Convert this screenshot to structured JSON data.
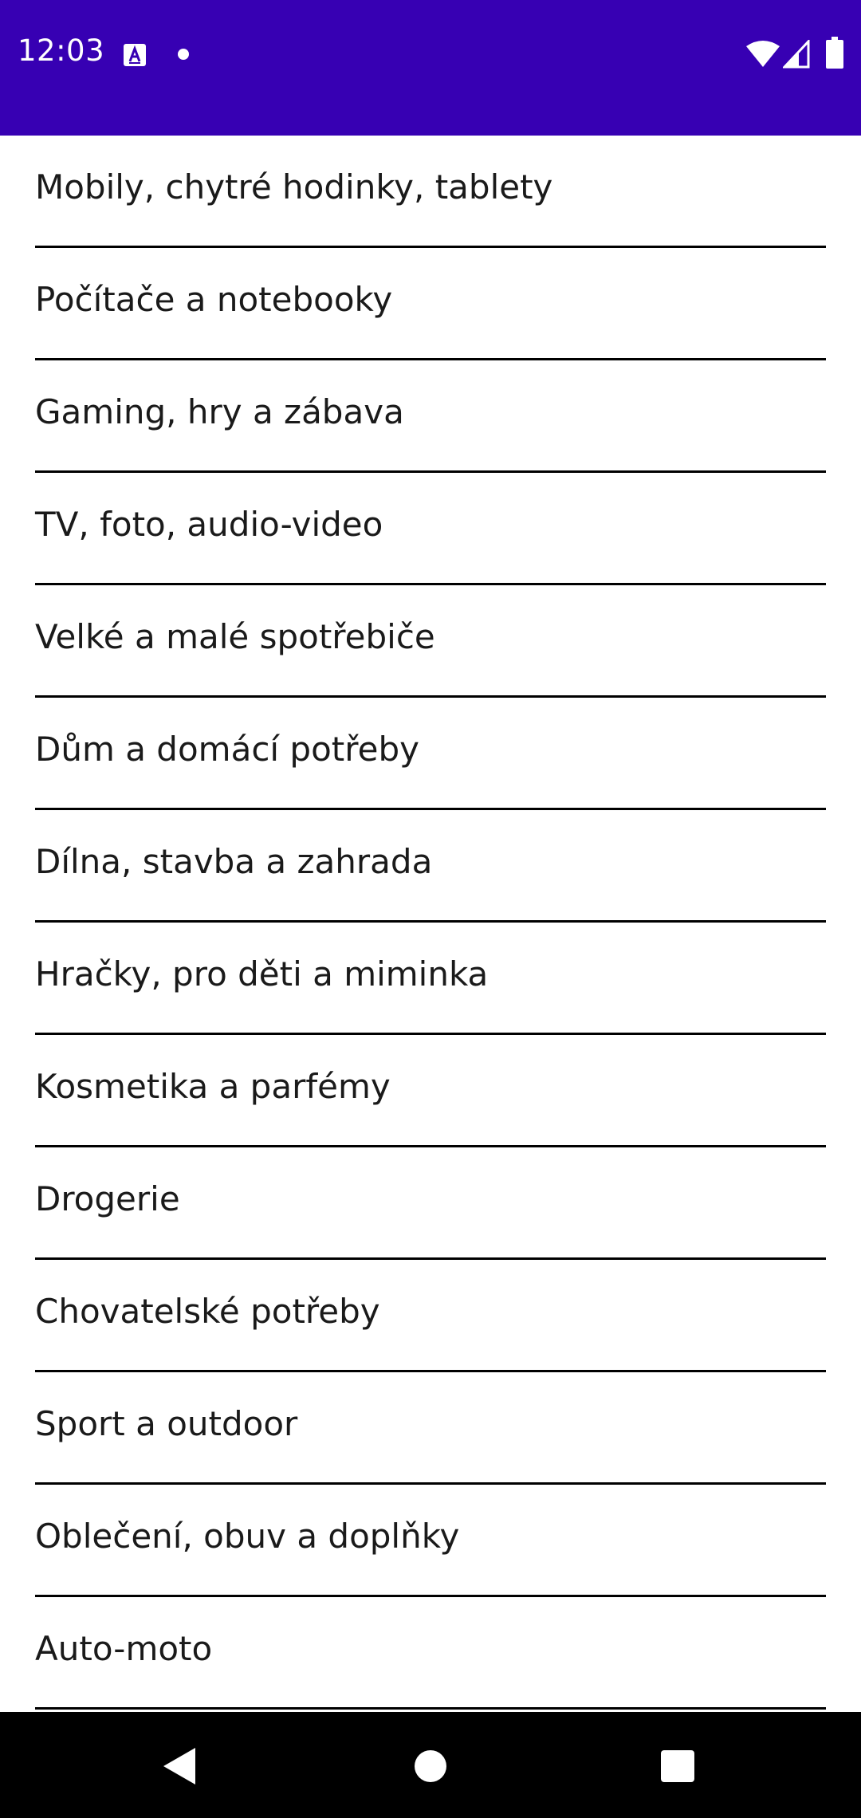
{
  "status_bar": {
    "time": "12:03",
    "icons": [
      "text-a-notification-icon",
      "notification-dot-icon",
      "wifi-icon",
      "cell-signal-icon",
      "battery-icon"
    ],
    "background_color": "#3700b3"
  },
  "categories": [
    {
      "label": "Mobily, chytré hodinky, tablety"
    },
    {
      "label": "Počítače a notebooky"
    },
    {
      "label": "Gaming, hry a zábava"
    },
    {
      "label": "TV, foto, audio-video"
    },
    {
      "label": "Velké a malé spotřebiče"
    },
    {
      "label": "Dům a domácí potřeby"
    },
    {
      "label": "Dílna, stavba a zahrada"
    },
    {
      "label": "Hračky, pro děti a miminka"
    },
    {
      "label": "Kosmetika a parfémy"
    },
    {
      "label": "Drogerie"
    },
    {
      "label": "Chovatelské potřeby"
    },
    {
      "label": "Sport a outdoor"
    },
    {
      "label": "Oblečení, obuv a doplňky"
    },
    {
      "label": "Auto-moto"
    }
  ],
  "nav_bar": {
    "icons": [
      "back-icon",
      "home-icon",
      "recents-icon"
    ],
    "background_color": "#000000"
  }
}
